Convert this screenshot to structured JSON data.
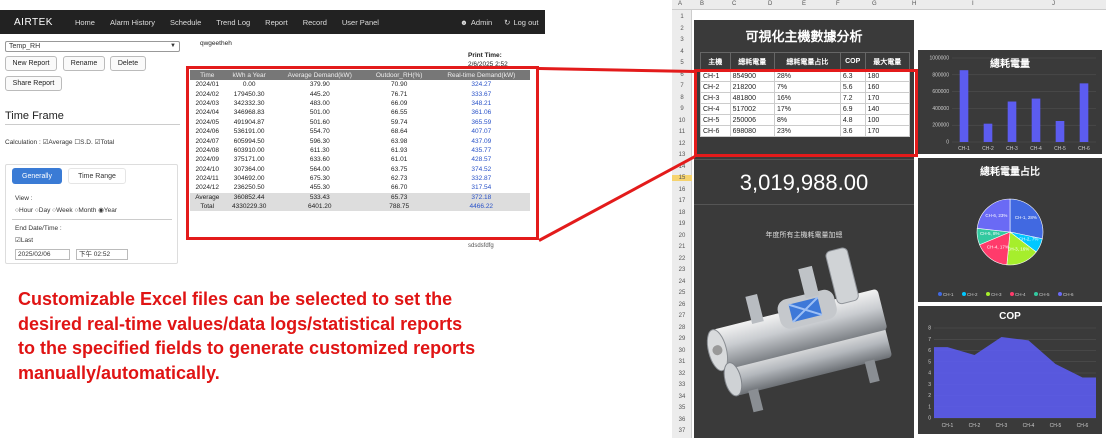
{
  "app": {
    "brand": "AIRTEK",
    "nav": [
      "Home",
      "Alarm History",
      "Schedule",
      "Trend Log",
      "Report",
      "Record",
      "User Panel"
    ],
    "user": "Admin",
    "logout": "Log out"
  },
  "sidebar": {
    "report_select": "Temp_RH",
    "new_report": "New Report",
    "rename": "Rename",
    "delete": "Delete",
    "share_report": "Share Report",
    "time_frame": "Time Frame",
    "calc_label": "Calculation :",
    "calc_options": [
      "Average",
      "S.D.",
      "Total"
    ],
    "tabs": [
      "Generally",
      "Time Range"
    ],
    "view_label": "View :",
    "view_options": [
      "Hour",
      "Day",
      "Week",
      "Month",
      "Year"
    ],
    "end_label": "End Date/Time :",
    "last_label": "Last",
    "end_date": "2025/02/06",
    "end_time": "下午 02:52"
  },
  "report": {
    "name": "qwgeetheh",
    "print_label": "Print Time:",
    "print_value": "2/6/2025 2:52",
    "columns": [
      "Time",
      "kWh a Year",
      "Average Demand(kW)",
      "Outdoor_RH(%)",
      "Real-time Demand(kW)"
    ],
    "rows": [
      [
        "2024/01",
        "0.00",
        "379.90",
        "70.90",
        "324.27"
      ],
      [
        "2024/02",
        "179450.30",
        "445.20",
        "76.71",
        "333.67"
      ],
      [
        "2024/03",
        "342332.30",
        "483.00",
        "66.09",
        "348.21"
      ],
      [
        "2024/04",
        "346968.83",
        "501.00",
        "66.55",
        "361.06"
      ],
      [
        "2024/05",
        "491904.87",
        "501.60",
        "59.74",
        "365.59"
      ],
      [
        "2024/06",
        "536191.00",
        "554.70",
        "68.64",
        "407.07"
      ],
      [
        "2024/07",
        "605994.50",
        "596.30",
        "63.98",
        "437.09"
      ],
      [
        "2024/08",
        "603910.00",
        "611.30",
        "61.93",
        "435.77"
      ],
      [
        "2024/09",
        "375171.00",
        "633.60",
        "61.01",
        "428.57"
      ],
      [
        "2024/10",
        "307364.00",
        "564.00",
        "63.75",
        "374.52"
      ],
      [
        "2024/11",
        "304692.00",
        "675.30",
        "62.73",
        "332.87"
      ],
      [
        "2024/12",
        "236250.50",
        "455.30",
        "66.70",
        "317.54"
      ]
    ],
    "summary": [
      [
        "Average",
        "360852.44",
        "533.43",
        "65.73",
        "372.18"
      ],
      [
        "Total",
        "4330229.30",
        "6401.20",
        "788.75",
        "4466.22"
      ]
    ],
    "footer": "sdsdsfdfg"
  },
  "excel": {
    "col_letters": [
      "A",
      "B",
      "C",
      "D",
      "E",
      "F",
      "G",
      "H",
      "I",
      "J"
    ],
    "row_numbers": [
      "1",
      "2",
      "3",
      "4",
      "5",
      "6",
      "7",
      "8",
      "9",
      "10",
      "11",
      "12",
      "13",
      "14",
      "15",
      "16",
      "17",
      "18",
      "19",
      "20",
      "21",
      "22",
      "23",
      "24",
      "25",
      "26",
      "27",
      "28",
      "29",
      "30",
      "31",
      "32",
      "33",
      "34",
      "35",
      "36",
      "37"
    ],
    "title": "可視化主機數據分析",
    "table_headers": [
      "主機",
      "總耗電量",
      "總耗電量占比",
      "COP",
      "最大電量"
    ],
    "table_rows": [
      [
        "CH-1",
        "854900",
        "28%",
        "6.3",
        "180"
      ],
      [
        "CH-2",
        "218200",
        "7%",
        "5.6",
        "160"
      ],
      [
        "CH-3",
        "481800",
        "16%",
        "7.2",
        "170"
      ],
      [
        "CH-4",
        "517002",
        "17%",
        "6.9",
        "140"
      ],
      [
        "CH-5",
        "250006",
        "8%",
        "4.8",
        "100"
      ],
      [
        "CH-6",
        "698080",
        "23%",
        "3.6",
        "170"
      ]
    ],
    "total": "3,019,988.00",
    "chiller_caption": "年度所有主機耗電量加總"
  },
  "caption": {
    "lines": [
      "Customizable Excel files can be selected to set the",
      "desired real-time values/data logs/statistical reports",
      "to the specified fields to generate customized reports",
      "manually/automatically."
    ]
  },
  "colors": {
    "accent": "#e31b1b",
    "bar": "#5c5cf0",
    "tab": "#3a7bd5",
    "link": "#2952c8"
  },
  "chart_data": [
    {
      "type": "bar",
      "title": "總耗電量",
      "categories": [
        "CH-1",
        "CH-2",
        "CH-3",
        "CH-4",
        "CH-5",
        "CH-6"
      ],
      "values": [
        854900,
        218200,
        481800,
        517002,
        250006,
        698080
      ],
      "ylim": [
        0,
        1000000
      ],
      "yticks": [
        "1000000",
        "800000",
        "600000",
        "400000",
        "200000",
        "0"
      ]
    },
    {
      "type": "pie",
      "title": "總耗電量占比",
      "categories": [
        "CH-1",
        "CH-2",
        "CH-3",
        "CH-4",
        "CH-5",
        "CH-6"
      ],
      "values": [
        28,
        7,
        16,
        17,
        8,
        23
      ],
      "labels": [
        "CH-1, 28%",
        "CH-2, 7%",
        "CH-3, 16%",
        "CH-4, 17%",
        "CH-5, 8%",
        "CH-6, 23%"
      ],
      "colors": [
        "#4169e1",
        "#00c8ff",
        "#a6ee2c",
        "#ff3b6b",
        "#33c9a0",
        "#6a6af5"
      ],
      "legend": "bottom"
    },
    {
      "type": "area",
      "title": "COP",
      "categories": [
        "CH-1",
        "CH-2",
        "CH-3",
        "CH-4",
        "CH-5",
        "CH-6"
      ],
      "values": [
        6.3,
        5.6,
        7.2,
        6.9,
        4.8,
        3.6
      ],
      "ylim": [
        0,
        8
      ],
      "yticks": [
        "8",
        "7",
        "6",
        "5",
        "4",
        "3",
        "2",
        "1",
        "0"
      ]
    }
  ]
}
